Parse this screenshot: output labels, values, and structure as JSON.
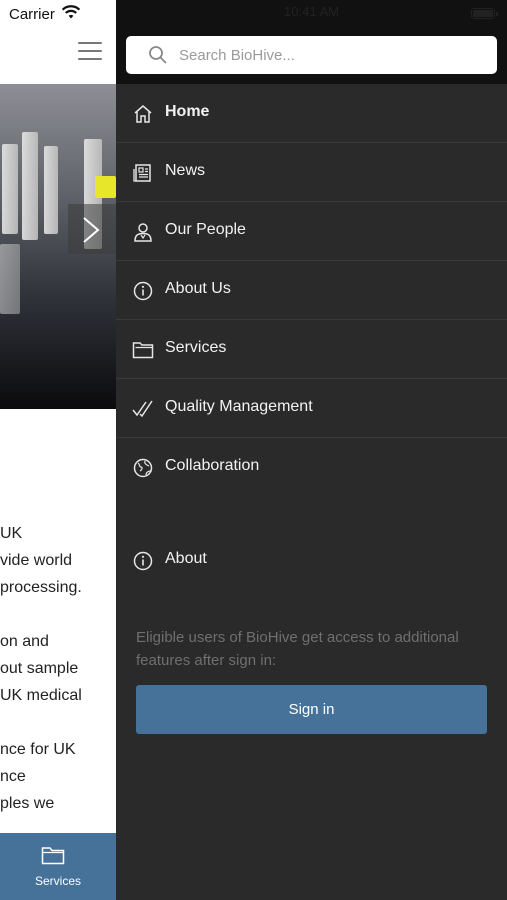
{
  "status_bar": {
    "carrier": "Carrier",
    "time": "10:41 AM"
  },
  "page": {
    "body_paragraphs": [
      "UK\nvide world\nprocessing.",
      "on and\nout sample\nUK medical",
      "nce for UK\nnce\nples we"
    ],
    "tab_bar": {
      "label": "Services",
      "icon": "folder-icon"
    }
  },
  "drawer": {
    "search": {
      "placeholder": "Search BioHive..."
    },
    "menu": [
      {
        "label": "Home",
        "icon": "home-icon",
        "active": true
      },
      {
        "label": "News",
        "icon": "news-icon"
      },
      {
        "label": "Our People",
        "icon": "person-icon"
      },
      {
        "label": "About Us",
        "icon": "info-icon"
      },
      {
        "label": "Services",
        "icon": "folder-icon"
      },
      {
        "label": "Quality Management",
        "icon": "checkmarks-icon"
      },
      {
        "label": "Collaboration",
        "icon": "globe-icon"
      }
    ],
    "about": {
      "label": "About",
      "icon": "info-icon"
    },
    "signin_info": "Eligible users of BioHive get access to additional features after sign in:",
    "signin_button": "Sign in"
  },
  "colors": {
    "accent": "#46729a",
    "drawer_bg": "#2a2a2a",
    "drawer_top": "#111111"
  }
}
